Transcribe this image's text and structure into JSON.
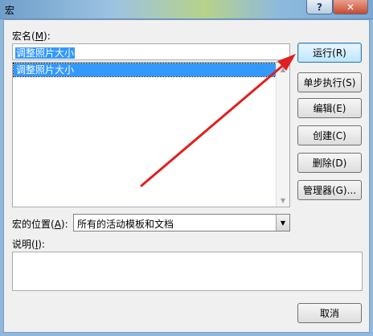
{
  "window": {
    "title": "宏",
    "help_label": "?",
    "close_label": "✕"
  },
  "macro_name": {
    "label_prefix": "宏名(",
    "label_key": "M",
    "label_suffix": "):",
    "value": "调整照片大小"
  },
  "macro_list": {
    "items": [
      "调整照片大小"
    ],
    "selected_index": 0
  },
  "buttons": {
    "run": "运行(R)",
    "step_into": "单步执行(S)",
    "edit": "编辑(E)",
    "create": "创建(C)",
    "delete": "删除(D)",
    "organizer": "管理器(G)...",
    "cancel": "取消"
  },
  "location": {
    "label_prefix": "宏的位置(",
    "label_key": "A",
    "label_suffix": "):",
    "value": "所有的活动模板和文档"
  },
  "description": {
    "label_prefix": "说明(",
    "label_key": "I",
    "label_suffix": "):",
    "value": ""
  },
  "colors": {
    "annotation_arrow": "#e02020",
    "selection": "#3399ff"
  }
}
